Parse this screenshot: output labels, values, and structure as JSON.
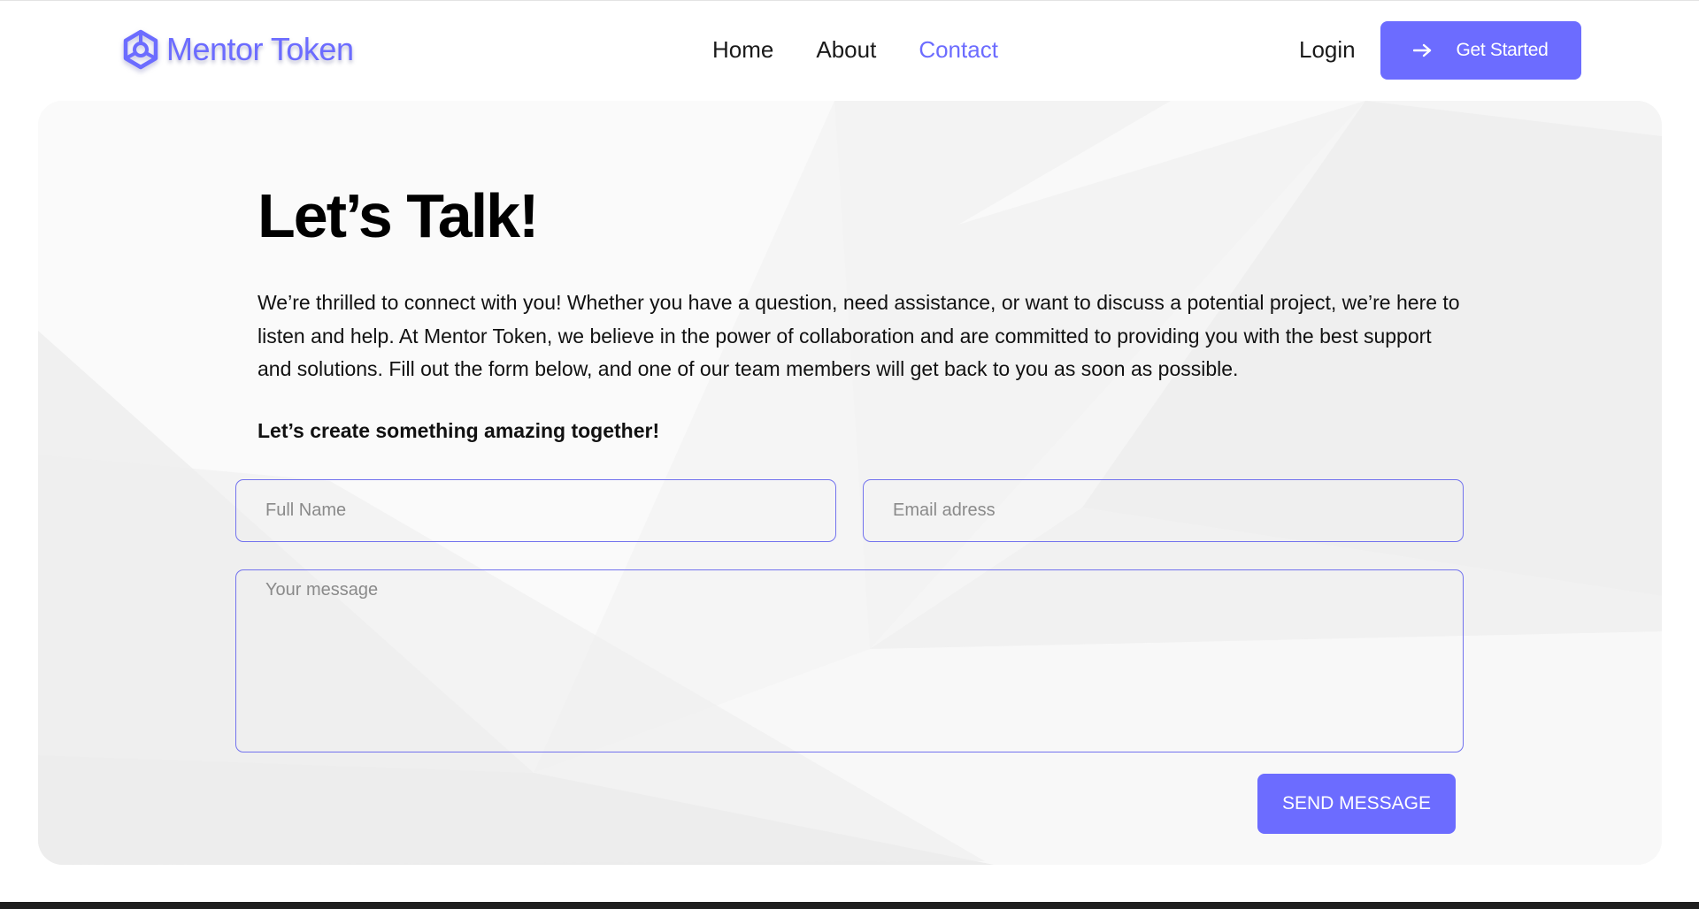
{
  "brand": {
    "name": "Mentor Token",
    "accent_color": "#6c6cff"
  },
  "nav": {
    "items": [
      {
        "label": "Home",
        "active": false
      },
      {
        "label": "About",
        "active": false
      },
      {
        "label": "Contact",
        "active": true
      }
    ],
    "login_label": "Login",
    "cta_label": "Get Started",
    "cta_icon": "arrow-right-icon"
  },
  "contact": {
    "title": "Let’s Talk!",
    "intro": "We’re thrilled to connect with you! Whether you have a question, need assistance, or want to discuss a potential project, we’re here to listen and help. At Mentor Token, we believe in the power of collaboration and are committed to providing you with the best support and solutions. Fill out the form below, and one of our team members will get back to you as soon as possible.",
    "tagline": "Let’s create something amazing together!",
    "form": {
      "name_placeholder": "Full Name",
      "email_placeholder": "Email adress",
      "message_placeholder": "Your message",
      "submit_label": "SEND MESSAGE"
    }
  }
}
